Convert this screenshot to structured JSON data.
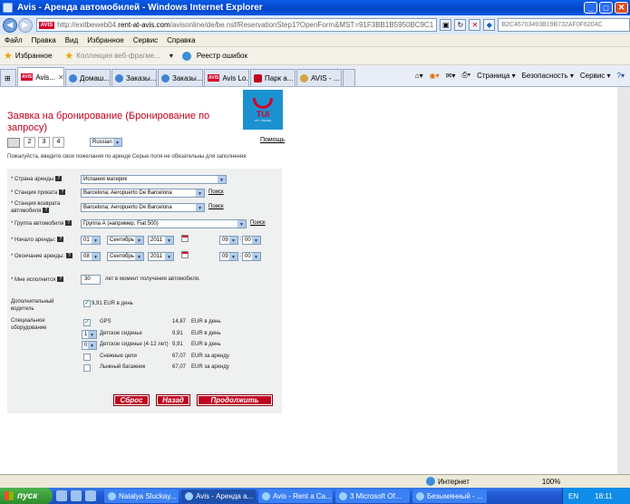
{
  "window": {
    "title": "Avis - Аренда автомобилей - Windows Internet Explorer"
  },
  "address_bar": {
    "url_prefix": "http://exitbeweb04.",
    "url_domain": "rent-at-avis.com",
    "url_rest": "/avisonline/de/be.nsf/ReservationStep1?OpenForm&MST=91F3BB1B5950BC9C1",
    "search_text": "B2C46703493B19B732AF0F6204C"
  },
  "menu": [
    "Файл",
    "Правка",
    "Вид",
    "Избранное",
    "Сервис",
    "Справка"
  ],
  "favorites_bar": {
    "favorites": "Избранное",
    "web_slices": "Коллекция веб-фрагме...",
    "error_log": "Реестр ошибок"
  },
  "tabs": [
    {
      "label": "Avis...",
      "kind": "avis",
      "active": true
    },
    {
      "label": "Домаш...",
      "kind": "ie"
    },
    {
      "label": "Заказы...",
      "kind": "ie"
    },
    {
      "label": "Заказы...",
      "kind": "ie"
    },
    {
      "label": "Avis Lo...",
      "kind": "avis"
    },
    {
      "label": "Парк а...",
      "kind": "car"
    },
    {
      "label": "AVIS - ...",
      "kind": "person"
    }
  ],
  "command_bar": {
    "page": "Страница ▾",
    "safety": "Безопасность ▾",
    "tools": "Сервис ▾"
  },
  "page": {
    "title": "Заявка на бронирование (Бронирование по запросу)",
    "help": "Помощь",
    "steps": [
      "2",
      "3",
      "4"
    ],
    "language": "Russian",
    "hint": "Пожалуйста, введите свои пожелания по аренде Серые поля не обязательны для заполнения",
    "logo_text": "TUI",
    "logo_sub": "VTI • TRAVEL"
  },
  "form": {
    "country_label": "* Страна аренды",
    "country_value": "Испания материк",
    "pickup_station_label": "* Станция проката",
    "pickup_station_value": "Barcelona; Aeropuerto De Barcelona",
    "return_station_label": "* Станция возврата автомобиля",
    "return_station_value": "Barcelona; Aeropuerto De Barcelona",
    "search_link": "Поиск",
    "car_group_label": "* Группа автомобиля",
    "car_group_value": "Группа А (например, Fiat 500)",
    "start_label": "* Начало аренды:",
    "start_day": "01",
    "start_month": "Сентябрь",
    "start_year": "2011",
    "start_hour": "09",
    "start_min": "00",
    "end_label": "* Окончание аренды:",
    "end_day": "08",
    "end_month": "Сентябрь",
    "end_year": "2011",
    "end_hour": "09",
    "end_min": "00",
    "age_label": "* Мне исполнится",
    "age_value": "30",
    "age_suffix": "лет в момент получения автомобиля.",
    "extra_driver_label": "Дополнительный водитель",
    "extra_driver_price": "9,91 EUR в день",
    "equipment_label": "Специальное оборудование",
    "equipment": [
      {
        "control": "check",
        "checked": true,
        "qty": "",
        "name": "GPS",
        "price": "14,87",
        "unit": "EUR  в день"
      },
      {
        "control": "select",
        "checked": false,
        "qty": "1",
        "name": "Детское сиденье",
        "price": "9,91",
        "unit": "EUR  в день"
      },
      {
        "control": "select",
        "checked": false,
        "qty": "0",
        "name": "Детское сиденье (4-12 лет)",
        "price": "9,91",
        "unit": "EUR  в день"
      },
      {
        "control": "check",
        "checked": false,
        "qty": "",
        "name": "Снежные цепи",
        "price": "67,07",
        "unit": "EUR  за аренду"
      },
      {
        "control": "check",
        "checked": false,
        "qty": "",
        "name": "Лыжный багажник",
        "price": "67,07",
        "unit": "EUR  за аренду"
      }
    ],
    "reset_button": "Сброс",
    "back_button": "Назад",
    "continue_button": "Продолжить"
  },
  "status_bar": {
    "zone": "Интернет",
    "zoom": "100%"
  },
  "taskbar": {
    "start": "пуск",
    "tasks": [
      {
        "label": "Natalya Sluckay...",
        "active": false
      },
      {
        "label": "Avis - Аренда а...",
        "active": true
      },
      {
        "label": "Avis - Rent a Ca...",
        "active": false
      },
      {
        "label": "3 Microsoft Of...",
        "active": false
      },
      {
        "label": "Безымянный - ...",
        "active": false
      }
    ],
    "lang": "EN",
    "time": "18:11"
  }
}
